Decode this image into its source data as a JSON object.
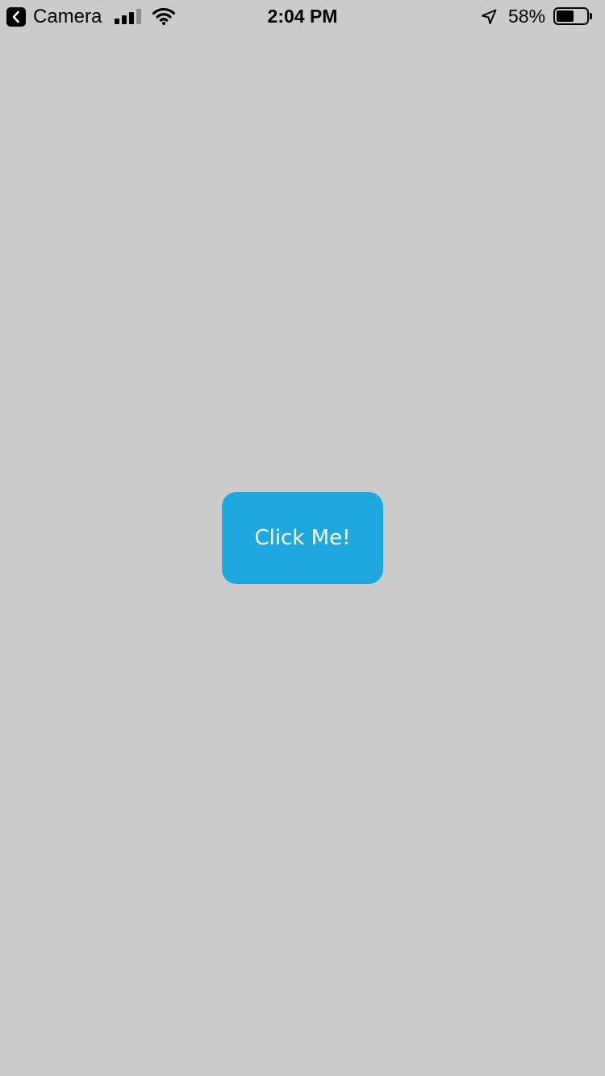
{
  "status_bar": {
    "back_app": "Camera",
    "back_icon": "chevron-left-icon",
    "time": "2:04 PM",
    "signal_bars_active": 3,
    "signal_bars_total": 4,
    "battery_percent": "58%",
    "battery_level": 0.58,
    "icons": [
      "signal-icon",
      "wifi-icon",
      "location-arrow-icon",
      "battery-icon"
    ]
  },
  "main": {
    "button_label": "Click Me!"
  },
  "colors": {
    "background": "#cbcbcb",
    "button": "#1fa8e0",
    "button_text": "#ffffff"
  }
}
